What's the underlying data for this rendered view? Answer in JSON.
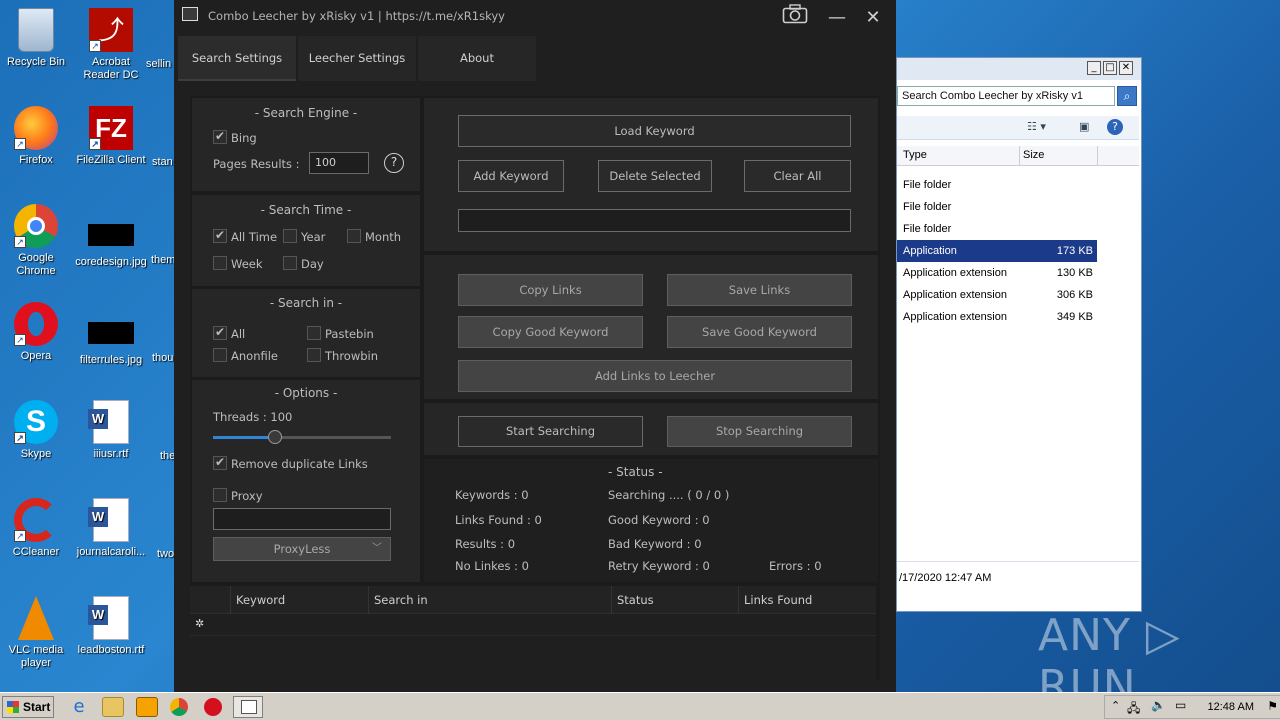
{
  "desktop": {
    "icons": [
      {
        "label": "Recycle Bin"
      },
      {
        "label": "Acrobat Reader DC"
      },
      {
        "label": "sellin"
      },
      {
        "label": "Firefox"
      },
      {
        "label": "FileZilla Client"
      },
      {
        "label": "stan"
      },
      {
        "label": "Google Chrome"
      },
      {
        "label": "coredesign.jpg"
      },
      {
        "label": "them"
      },
      {
        "label": "Opera"
      },
      {
        "label": "filterrules.jpg"
      },
      {
        "label": "thou"
      },
      {
        "label": "Skype"
      },
      {
        "label": "iiiusr.rtf"
      },
      {
        "label": "the"
      },
      {
        "label": "CCleaner"
      },
      {
        "label": "journalcaroli..."
      },
      {
        "label": "two"
      },
      {
        "label": "VLC media player"
      },
      {
        "label": "leadboston.rtf"
      }
    ]
  },
  "explorer": {
    "search_text": "Search Combo Leecher by xRisky v1",
    "col_type": "Type",
    "col_size": "Size",
    "rows": [
      {
        "type": "File folder",
        "size": ""
      },
      {
        "type": "File folder",
        "size": ""
      },
      {
        "type": "File folder",
        "size": ""
      },
      {
        "type": "Application",
        "size": "173 KB"
      },
      {
        "type": "Application extension",
        "size": "130 KB"
      },
      {
        "type": "Application extension",
        "size": "306 KB"
      },
      {
        "type": "Application extension",
        "size": "349 KB"
      }
    ],
    "detail": "/17/2020 12:47 AM"
  },
  "app": {
    "title": "Combo Leecher by xRisky v1 | https://t.me/xR1skyy",
    "tabs": [
      "Search Settings",
      "Leecher Settings",
      "About"
    ],
    "search_engine": {
      "title": "- Search Engine -",
      "bing_label": "Bing",
      "pages_label": "Pages Results :",
      "pages_value": "100",
      "help": "?"
    },
    "search_time": {
      "title": "- Search Time -",
      "all_time": "All Time",
      "year": "Year",
      "month": "Month",
      "week": "Week",
      "day": "Day"
    },
    "search_in": {
      "title": "- Search in -",
      "all": "All",
      "pastebin": "Pastebin",
      "anonfile": "Anonfile",
      "throwbin": "Throwbin"
    },
    "options": {
      "title": "- Options -",
      "threads_label": "Threads : 100",
      "threads_fraction": 0.35,
      "remove_dup": "Remove duplicate Links",
      "proxy": "Proxy",
      "proxy_type": "ProxyLess"
    },
    "buttons": {
      "load_keyword": "Load Keyword",
      "add_keyword": "Add Keyword",
      "delete_selected": "Delete Selected",
      "clear_all": "Clear All",
      "copy_links": "Copy Links",
      "save_links": "Save Links",
      "copy_good_keyword": "Copy Good Keyword",
      "save_good_keyword": "Save Good Keyword",
      "add_links_to_leecher": "Add Links to Leecher",
      "start_searching": "Start Searching",
      "stop_searching": "Stop Searching"
    },
    "status": {
      "title": "-  Status  -",
      "keywords": "Keywords : 0",
      "searching": "Searching .... ( 0 / 0 )",
      "links_found": "Links Found : 0",
      "good_keyword": "Good Keyword : 0",
      "results": "Results : 0",
      "bad_keyword": "Bad Keyword : 0",
      "no_linkes": "No Linkes : 0",
      "retry_keyword": "Retry Keyword : 0",
      "errors": "Errors : 0"
    },
    "grid": {
      "columns": [
        "Keyword",
        "Search in",
        "Status",
        "Links Found"
      ]
    }
  },
  "taskbar": {
    "start_label": "Start",
    "clock": "12:48 AM"
  },
  "watermark": "ANY ▷ RUN"
}
